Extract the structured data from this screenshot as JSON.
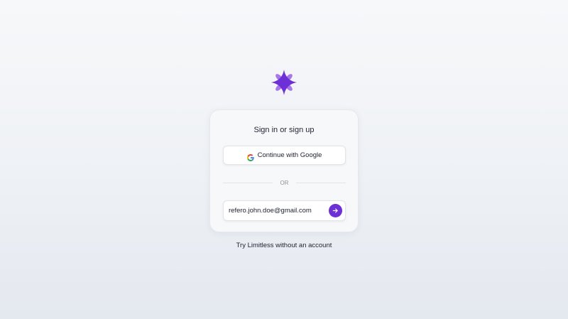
{
  "brand": {
    "logo_icon": "flower-sparkle-icon",
    "accent_color": "#6d2fd6"
  },
  "auth_card": {
    "title": "Sign in or sign up",
    "google_button": {
      "icon": "google-icon",
      "label": "Continue with Google"
    },
    "divider_text": "OR",
    "email_field": {
      "value": "refero.john.doe@gmail.com"
    },
    "submit_button": {
      "icon": "arrow-right-icon"
    }
  },
  "guest_link": {
    "label": "Try Limitless without an account"
  }
}
